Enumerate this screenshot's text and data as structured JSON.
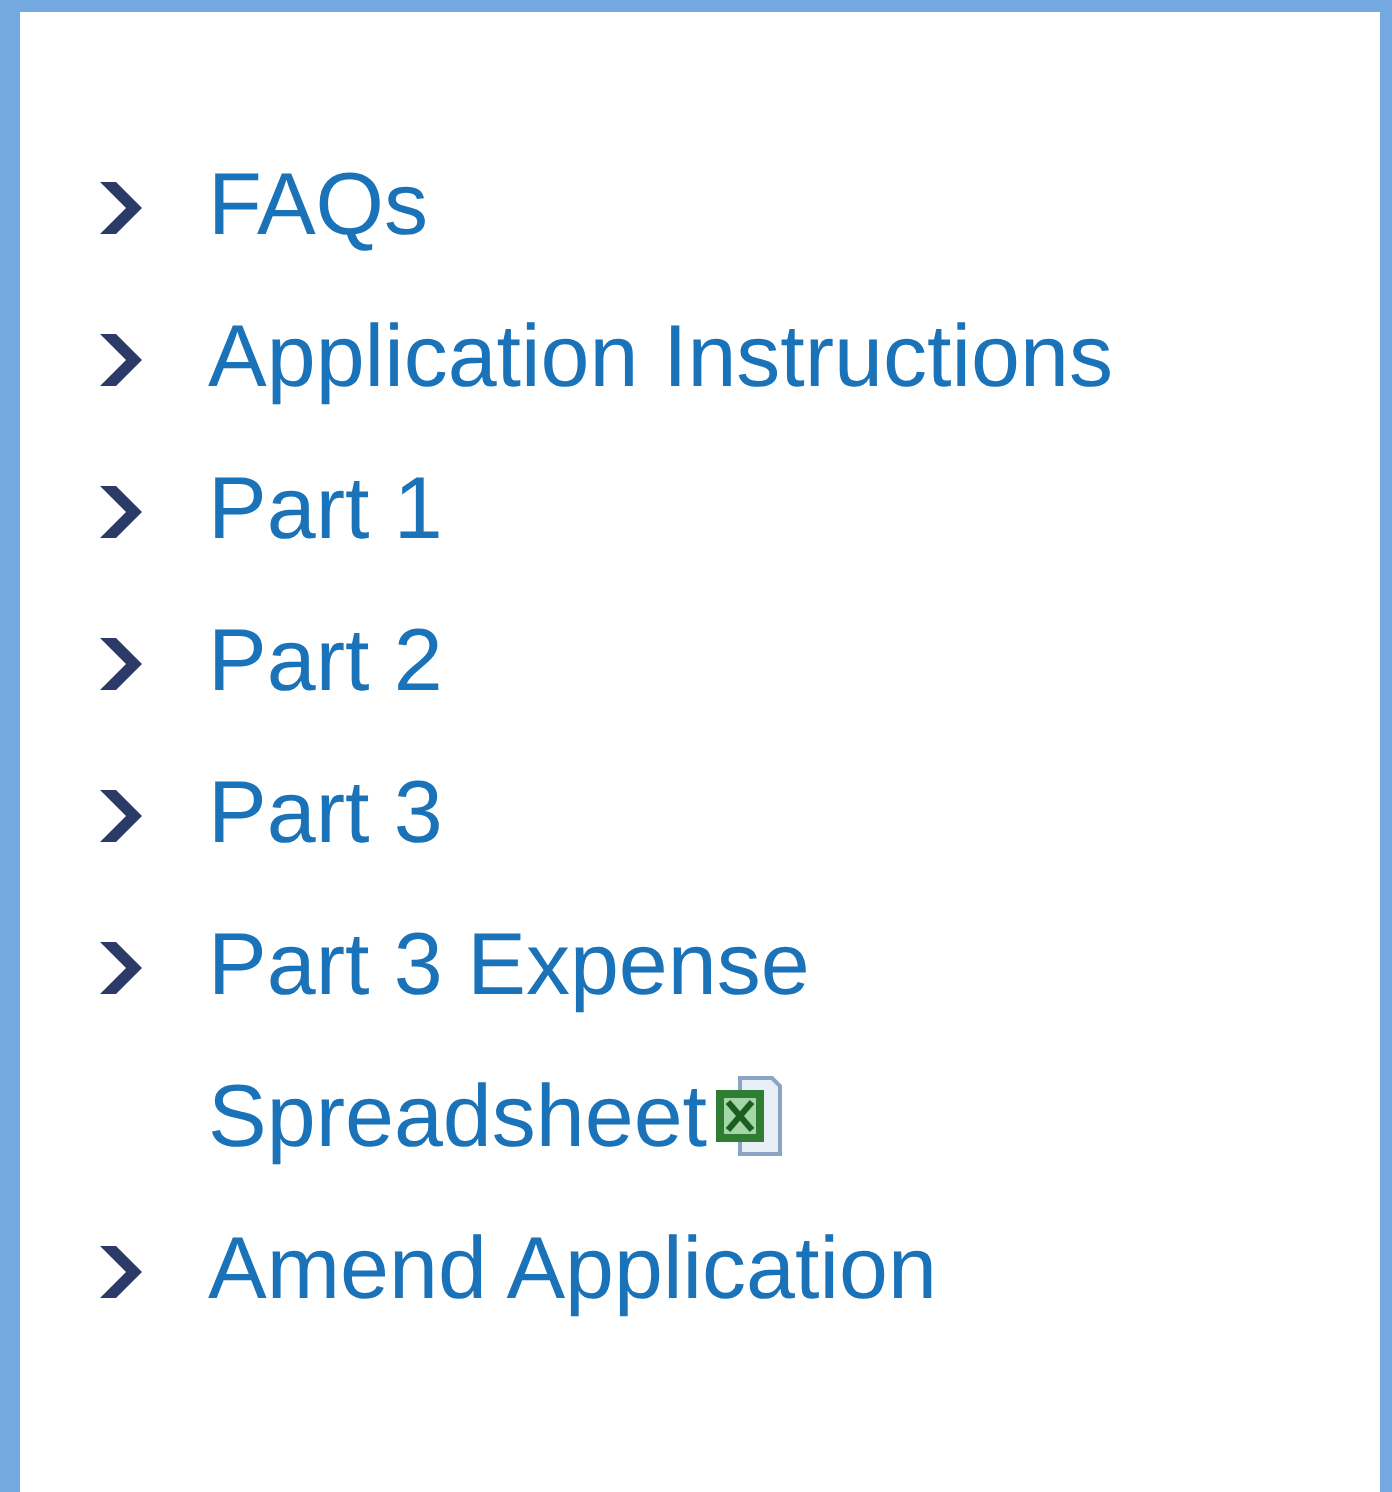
{
  "links": [
    {
      "label": "FAQs",
      "kind": "page"
    },
    {
      "label": "Application Instructions",
      "kind": "page"
    },
    {
      "label": "Part 1",
      "kind": "page"
    },
    {
      "label": "Part 2",
      "kind": "page"
    },
    {
      "label": "Part 3",
      "kind": "page"
    },
    {
      "label": "Part 3 Expense Spreadsheet",
      "kind": "spreadsheet"
    },
    {
      "label": "Amend Application",
      "kind": "page"
    }
  ]
}
